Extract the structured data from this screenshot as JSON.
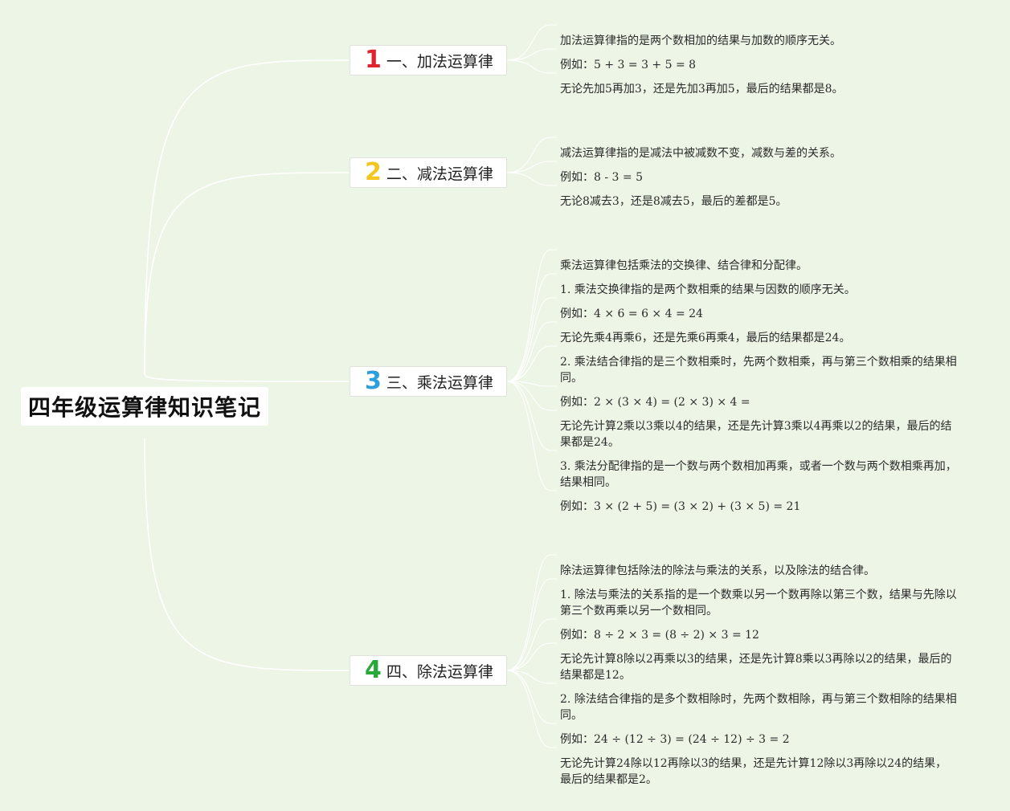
{
  "root": {
    "title": "四年级运算律知识笔记"
  },
  "branches": [
    {
      "number": "1",
      "label": "一、加法运算律",
      "number_color": "#e0242f",
      "leaves": [
        "加法运算律指的是两个数相加的结果与加数的顺序无关。",
        "例如：5 + 3 = 3 + 5 = 8",
        "无论先加5再加3，还是先加3再加5，最后的结果都是8。"
      ]
    },
    {
      "number": "2",
      "label": "二、减法运算律",
      "number_color": "#f2c61f",
      "leaves": [
        "减法运算律指的是减法中被减数不变，减数与差的关系。",
        "例如：8 - 3 = 5",
        "无论8减去3，还是8减去5，最后的差都是5。"
      ]
    },
    {
      "number": "3",
      "label": "三、乘法运算律",
      "number_color": "#2d9fdc",
      "leaves": [
        "乘法运算律包括乘法的交换律、结合律和分配律。",
        "1. 乘法交换律指的是两个数相乘的结果与因数的顺序无关。",
        "例如：4 × 6 = 6 × 4 = 24",
        "无论先乘4再乘6，还是先乘6再乘4，最后的结果都是24。",
        "2. 乘法结合律指的是三个数相乘时，先两个数相乘，再与第三个数相乘的结果相同。",
        "例如：2 × (3 × 4) = (2 × 3) × 4 =",
        "无论先计算2乘以3乘以4的结果，还是先计算3乘以4再乘以2的结果，最后的结果都是24。",
        "3. 乘法分配律指的是一个数与两个数相加再乘，或者一个数与两个数相乘再加，结果相同。",
        "例如：3 × (2 + 5) = (3 × 2) + (3 × 5) = 21"
      ]
    },
    {
      "number": "4",
      "label": "四、除法运算律",
      "number_color": "#27a83a",
      "leaves": [
        "除法运算律包括除法的除法与乘法的关系，以及除法的结合律。",
        "1. 除法与乘法的关系指的是一个数乘以另一个数再除以第三个数，结果与先除以第三个数再乘以另一个数相同。",
        "例如：8 ÷ 2 × 3 = (8 ÷ 2) × 3 = 12",
        "无论先计算8除以2再乘以3的结果，还是先计算8乘以3再除以2的结果，最后的结果都是12。",
        "2. 除法结合律指的是多个数相除时，先两个数相除，再与第三个数相除的结果相同。",
        "例如：24 ÷ (12 ÷ 3) = (24 ÷ 12) ÷ 3 = 2",
        "无论先计算24除以12再除以3的结果，还是先计算12除以3再除以24的结果，最后的结果都是2。"
      ]
    }
  ],
  "colors": {
    "background": "#edf5e6",
    "connector": "#ffffff"
  }
}
